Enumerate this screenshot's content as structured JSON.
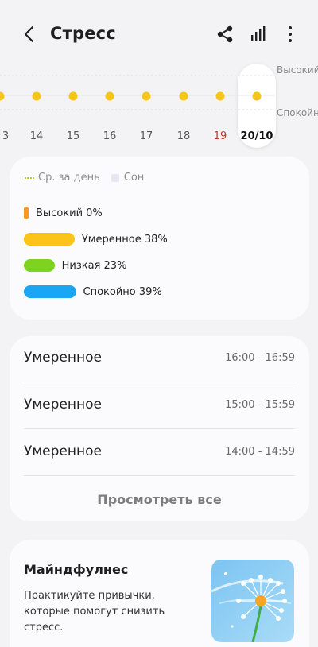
{
  "header": {
    "title": "Стресс",
    "back_icon": "chevron-left-icon",
    "share_icon": "share-icon",
    "chart_icon": "bar-chart-icon",
    "more_icon": "more-vertical-icon"
  },
  "chart_strip": {
    "days": [
      "3",
      "14",
      "15",
      "16",
      "17",
      "18",
      "19",
      "20/10"
    ],
    "weekend_day": "19",
    "selected_day": "20/10",
    "level_high": "Высокий",
    "level_calm": "Спокойно",
    "dot_color": "#f5c518",
    "dot_level": "moderate"
  },
  "legend": {
    "avg_label": "Ср. за день",
    "sleep_label": "Сон",
    "levels": [
      {
        "label": "Высокий 0%",
        "percent": 0,
        "color": "#f59a23"
      },
      {
        "label": "Умеренное 38%",
        "percent": 38,
        "color": "#fcc419"
      },
      {
        "label": "Низкая 23%",
        "percent": 23,
        "color": "#7ed321"
      },
      {
        "label": "Спокойно 39%",
        "percent": 39,
        "color": "#1aa6f2"
      }
    ]
  },
  "history": {
    "rows": [
      {
        "name": "Умеренное",
        "time": "16:00 - 16:59"
      },
      {
        "name": "Умеренное",
        "time": "15:00 - 15:59"
      },
      {
        "name": "Умеренное",
        "time": "14:00 - 14:59"
      }
    ],
    "view_all": "Просмотреть все"
  },
  "mindfulness": {
    "title": "Майндфулнес",
    "description": "Практикуйте привычки, которые помогут снизить стресс.",
    "image_icon": "dandelion-illustration"
  }
}
